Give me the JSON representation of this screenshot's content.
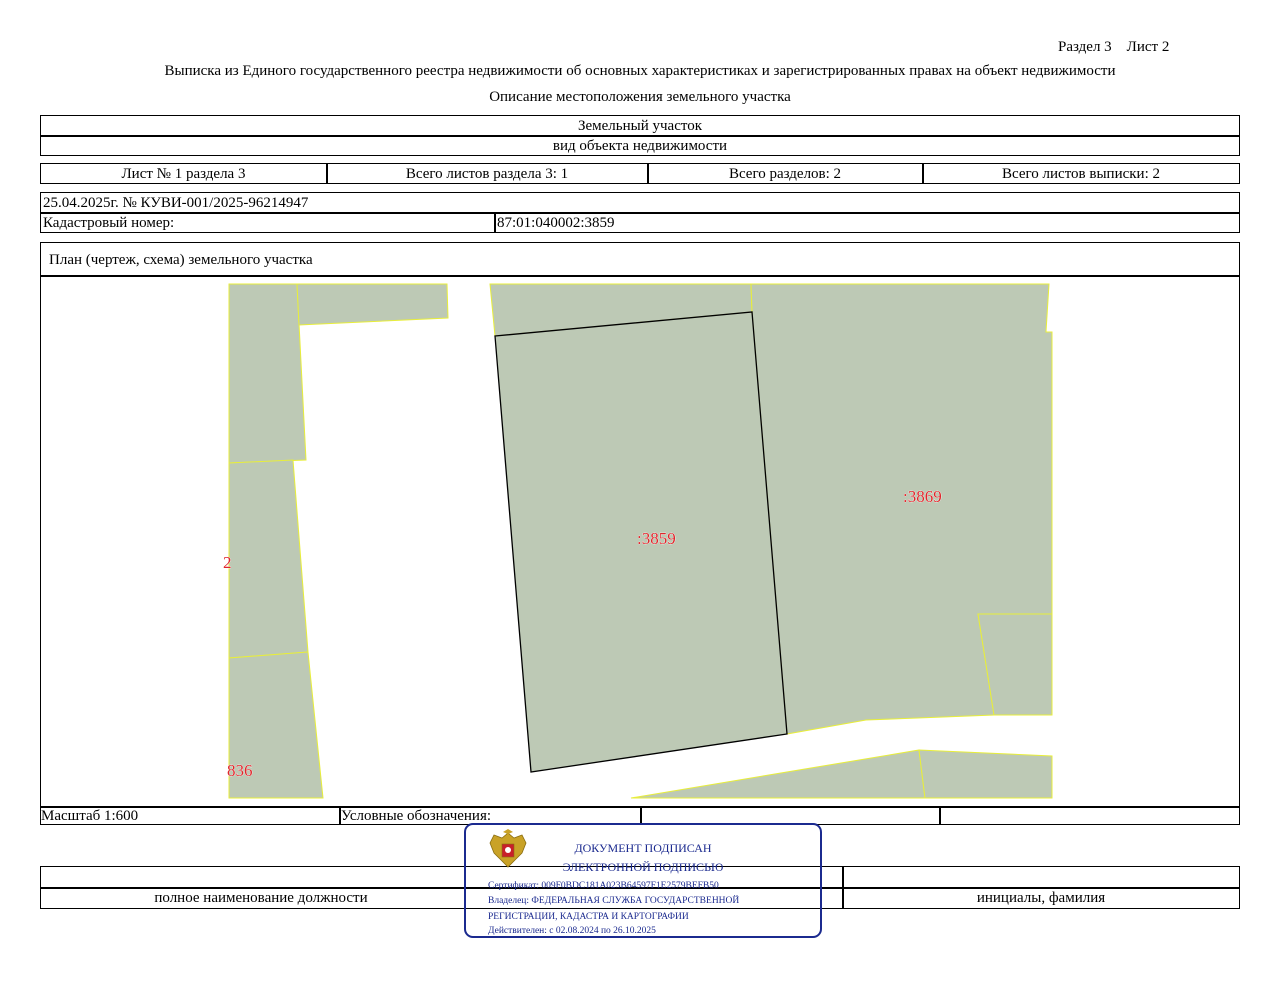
{
  "header": {
    "section_sheet": "Раздел 3    Лист 2",
    "title": "Выписка из Единого государственного реестра недвижимости об основных характеристиках и зарегистрированных правах на объект недвижимости",
    "subtitle": "Описание местоположения земельного участка"
  },
  "object": {
    "type": "Земельный участок",
    "type_caption": "вид объекта недвижимости"
  },
  "sheet_info": {
    "sheet": "Лист № 1 раздела 3",
    "total_sheets_section": "Всего листов раздела 3: 1",
    "total_sections": "Всего разделов: 2",
    "total_sheets": "Всего листов выписки: 2"
  },
  "record": {
    "date_number": "25.04.2025г. № КУВИ-001/2025-96214947",
    "cadastral_label": "Кадастровый номер:",
    "cadastral_value": "87:01:040002:3859"
  },
  "plan": {
    "title": "План (чертеж, схема) земельного участка",
    "labels": [
      ":3859",
      ":3869",
      "2",
      "836"
    ]
  },
  "footer": {
    "scale": "Масштаб 1:600",
    "legend": "Условные обозначения:",
    "position_caption": "полное наименование должности",
    "name_caption": "инициалы, фамилия"
  },
  "stamp": {
    "line1": "ДОКУМЕНТ ПОДПИСАН",
    "line2": "ЭЛЕКТРОННОЙ ПОДПИСЬЮ",
    "certificate": "Сертификат: 009F0BDC181A023B64597F1E2579BEFB50",
    "owner": "Владелец: ФЕДЕРАЛЬНАЯ СЛУЖБА ГОСУДАРСТВЕННОЙ",
    "owner2": "РЕГИСТРАЦИИ, КАДАСТРА И КАРТОГРАФИИ",
    "validity": "Действителен: с 02.08.2024 по 26.10.2025"
  },
  "colors": {
    "parcel_fill": "#bdc9b5",
    "neighbor_border": "#e8ee3a",
    "label": "#e0262b",
    "stamp": "#1b2a8f"
  }
}
